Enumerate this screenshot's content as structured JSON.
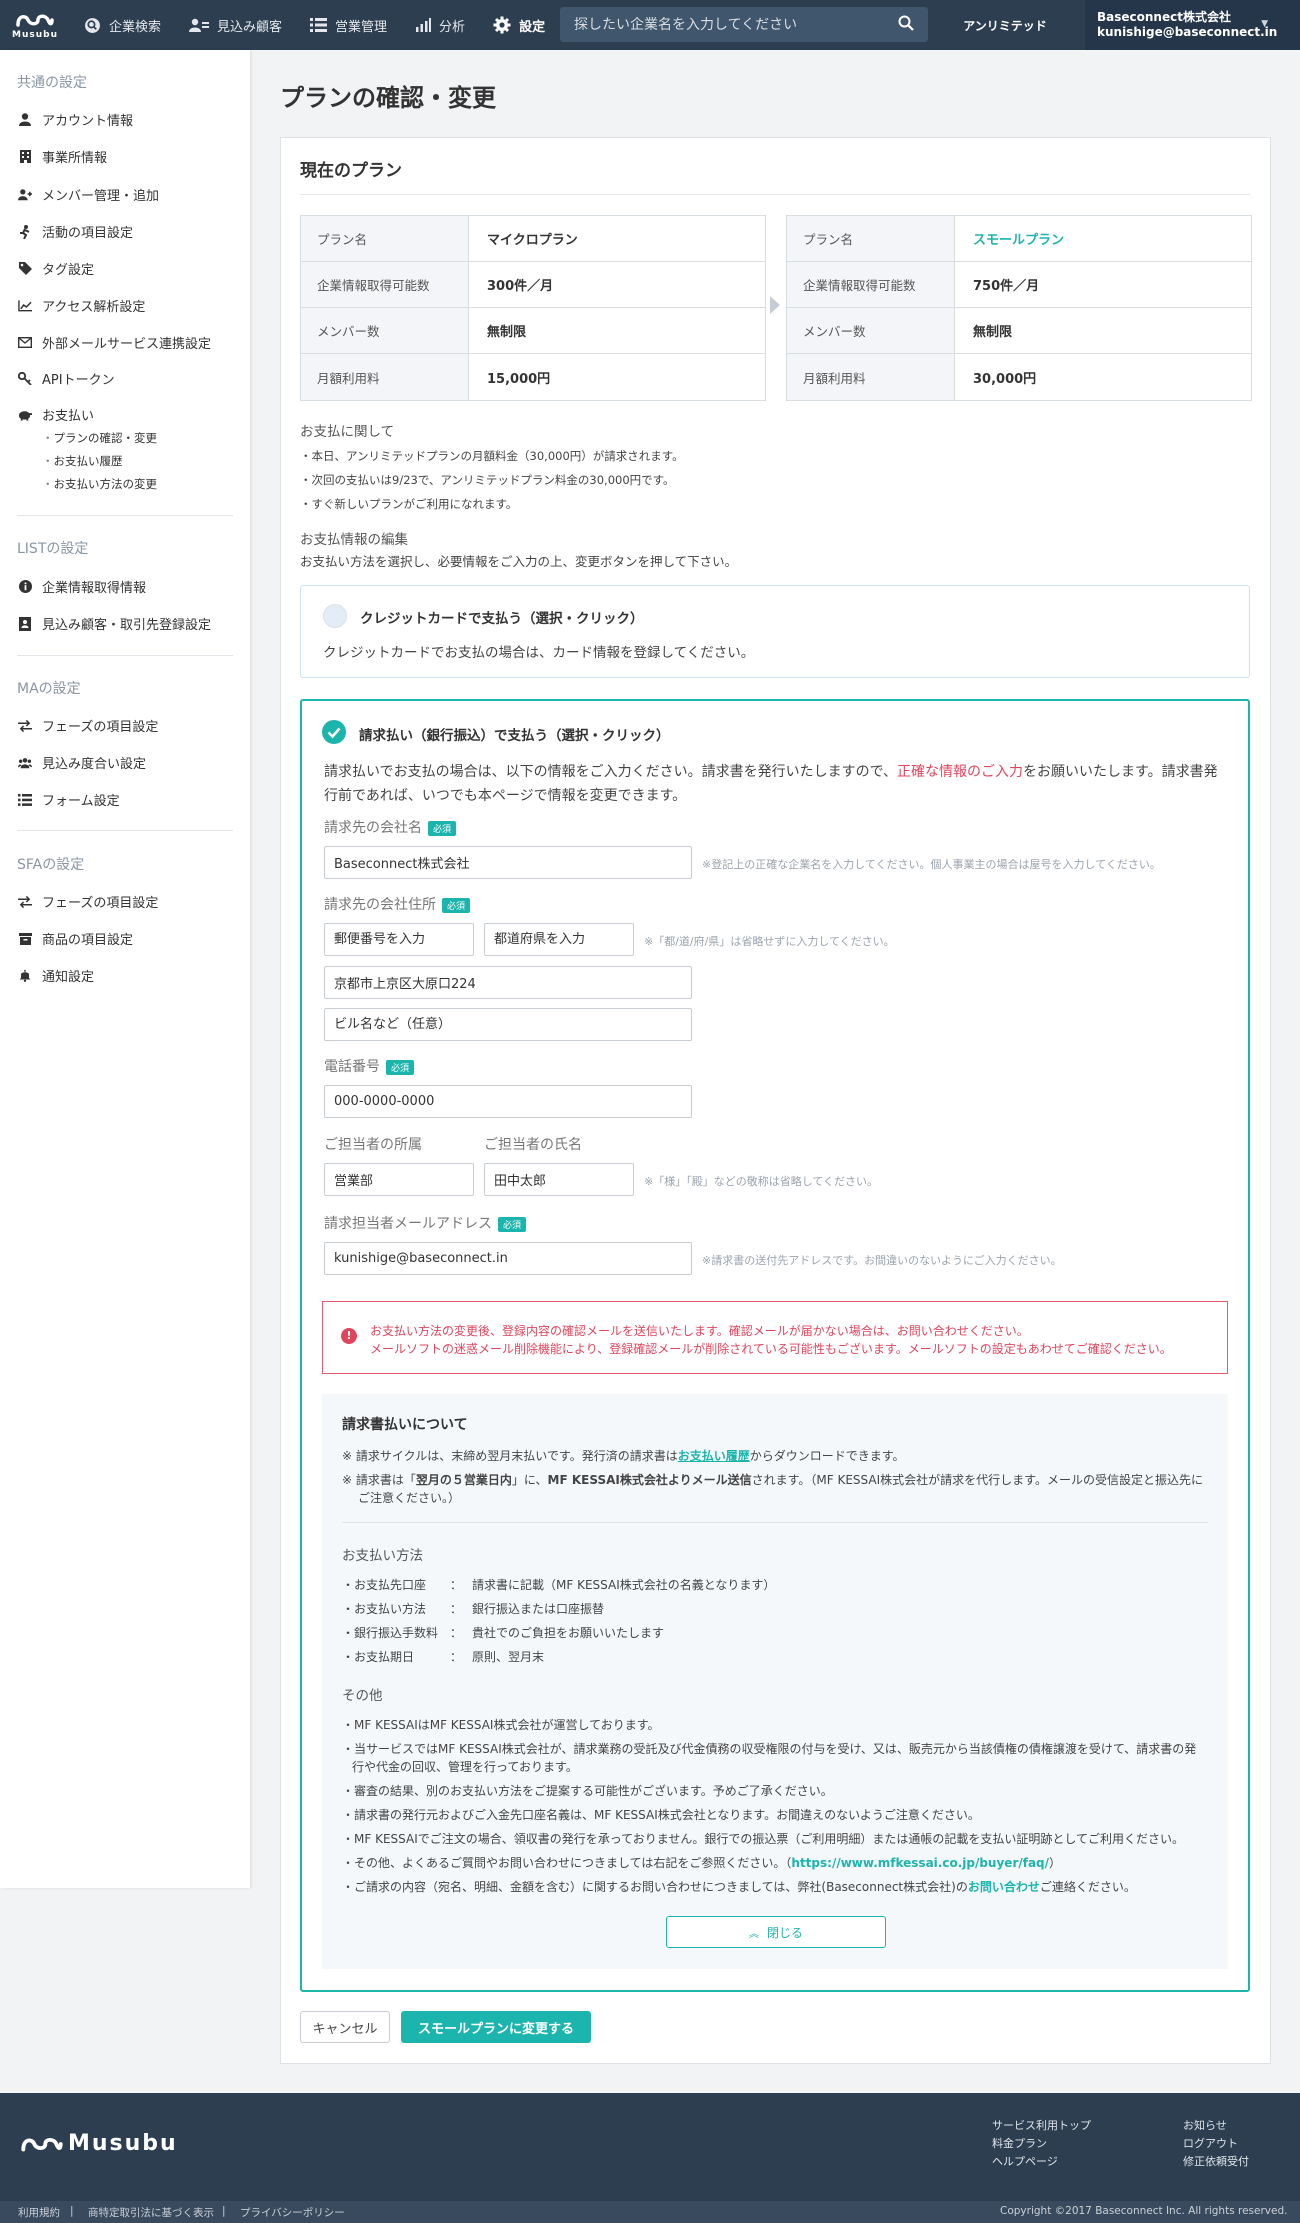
{
  "header": {
    "logo_text": "Musubu",
    "nav": [
      {
        "label": "企業検索",
        "icon": "search-circle-icon"
      },
      {
        "label": "見込み顧客",
        "icon": "users-icon"
      },
      {
        "label": "営業管理",
        "icon": "list-icon"
      },
      {
        "label": "分析",
        "icon": "bar-chart-icon"
      },
      {
        "label": "設定",
        "icon": "gear-icon"
      }
    ],
    "search_placeholder": "探したい企業名を入力してください",
    "plan_badge": "アンリミテッド",
    "company": "Baseconnect株式会社",
    "email": "kunishige@baseconnect.in"
  },
  "sidebar": {
    "common_title": "共通の設定",
    "common_items": [
      {
        "label": "アカウント情報",
        "icon": "user-icon"
      },
      {
        "label": "事業所情報",
        "icon": "building-icon"
      },
      {
        "label": "メンバー管理・追加",
        "icon": "user-plus-icon"
      },
      {
        "label": "活動の項目設定",
        "icon": "running-icon"
      },
      {
        "label": "タグ設定",
        "icon": "tag-icon"
      },
      {
        "label": "アクセス解析設定",
        "icon": "line-chart-icon"
      },
      {
        "label": "外部メールサービス連携設定",
        "icon": "envelope-icon"
      },
      {
        "label": "APIトークン",
        "icon": "key-icon"
      },
      {
        "label": "お支払い",
        "icon": "piggy-bank-icon"
      }
    ],
    "payment_sub": [
      "プランの確認・変更",
      "お支払い履歴",
      "お支払い方法の変更"
    ],
    "list_title": "LISTの設定",
    "list_items": [
      {
        "label": "企業情報取得情報",
        "icon": "info-icon"
      },
      {
        "label": "見込み顧客・取引先登録設定",
        "icon": "id-card-icon"
      }
    ],
    "ma_title": "MAの設定",
    "ma_items": [
      {
        "label": "フェーズの項目設定",
        "icon": "exchange-icon"
      },
      {
        "label": "見込み度合い設定",
        "icon": "group-icon"
      },
      {
        "label": "フォーム設定",
        "icon": "list-icon"
      }
    ],
    "sfa_title": "SFAの設定",
    "sfa_items": [
      {
        "label": "フェーズの項目設定",
        "icon": "exchange-icon"
      },
      {
        "label": "商品の項目設定",
        "icon": "archive-icon"
      },
      {
        "label": "通知設定",
        "icon": "bell-icon"
      }
    ]
  },
  "page": {
    "title": "プランの確認・変更",
    "current_plan_title": "現在のプラン"
  },
  "plans": {
    "current": [
      {
        "key": "プラン名",
        "value": "マイクロプラン"
      },
      {
        "key": "企業情報取得可能数",
        "value": "300件／月"
      },
      {
        "key": "メンバー数",
        "value": "無制限"
      },
      {
        "key": "月額利用料",
        "value": "15,000円"
      }
    ],
    "new": [
      {
        "key": "プラン名",
        "value": "スモールプラン"
      },
      {
        "key": "企業情報取得可能数",
        "value": "750件／月"
      },
      {
        "key": "メンバー数",
        "value": "無制限"
      },
      {
        "key": "月額利用料",
        "value": "30,000円"
      }
    ]
  },
  "payment_notes": {
    "title": "お支払に関して",
    "lines": [
      "・本日、アンリミテッドプランの月額料金（30,000円）が請求されます。",
      "・次回の支払いは9/23で、アンリミテッドプラン料金の30,000円です。",
      "・すぐ新しいプランがご利用になれます。"
    ],
    "edit_title": "お支払情報の編集",
    "edit_desc": "お支払い方法を選択し、必要情報をご入力の上、変更ボタンを押して下さい。"
  },
  "option_card": {
    "title": "クレジットカードで支払う（選択・クリック）",
    "desc": "クレジットカードでお支払の場合は、カード情報を登録してください。"
  },
  "option_invoice": {
    "title": "請求払い（銀行振込）で支払う（選択・クリック）",
    "desc_1": "請求払いでお支払の場合は、以下の情報をご入力ください。請求書を発行いたしますので、",
    "desc_highlight": "正確な情報のご入力",
    "desc_2": "をお願いいたします。請求書発",
    "desc_3": "行前であれば、いつでも本ページで情報を変更できます。"
  },
  "form": {
    "required": "必須",
    "company_label": "請求先の会社名",
    "company_value": "Baseconnect株式会社",
    "company_hint": "※登記上の正確な企業名を入力してください。個人事業主の場合は屋号を入力してください。",
    "address_label": "請求先の会社住所",
    "zip_placeholder": "郵便番号を入力",
    "pref_placeholder": "都道府県を入力",
    "address_hint": "※「都/道/府/県」は省略せずに入力してください。",
    "address_value": "京都市上京区大原口224",
    "building_placeholder": "ビル名など（任意）",
    "phone_label": "電話番号",
    "phone_value": "000-0000-0000",
    "dept_label": "ご担当者の所属",
    "name_label": "ご担当者の氏名",
    "dept_value": "営業部",
    "name_value": "田中太郎",
    "name_hint": "※「様」「殿」などの敬称は省略してください。",
    "email_label": "請求担当者メールアドレス",
    "email_value": "kunishige@baseconnect.in",
    "email_hint": "※請求書の送付先アドレスです。お間違いのないようにご入力ください。"
  },
  "alert": {
    "line1": "お支払い方法の変更後、登録内容の確認メールを送信いたします。確認メールが届かない場合は、お問い合わせください。",
    "line2": "メールソフトの迷惑メール削除機能により、登録確認メールが削除されている可能性もございます。メールソフトの設定もあわせてご確認ください。"
  },
  "invoice_info": {
    "title": "請求書払いについて",
    "note1_a": "※ 請求サイクルは、末締め翌月末払いです。発行済の請求書は",
    "note1_link": "お支払い履歴",
    "note1_b": "からダウンロードできます。",
    "note2_a": "※ 請求書は「",
    "note2_b": "翌月の５営業日内",
    "note2_c": "」に、",
    "note2_d": "MF KESSAI株式会社よりメール送信",
    "note2_e": "されます。（MF KESSAI株式会社が請求を代行します。メールの受信設定と振込先に",
    "note2_f": "ご注意ください。）",
    "method_title": "お支払い方法",
    "methods": [
      {
        "k": "・お支払先口座",
        "v": "請求書に記載（MF KESSAI株式会社の名義となります）"
      },
      {
        "k": "・お支払い方法",
        "v": "銀行振込または口座振替"
      },
      {
        "k": "・銀行振込手数料",
        "v": "貴社でのご負担をお願いいたします"
      },
      {
        "k": "・お支払期日",
        "v": "原則、翌月末"
      }
    ],
    "colon": "：",
    "other_title": "その他",
    "others": [
      "・MF KESSAIはMF KESSAI株式会社が運営しております。",
      "・当サービスではMF KESSAI株式会社が、請求業務の受託及び代金債務の収受権限の付与を受け、又は、販売元から当該債権の債権譲渡を受けて、請求書の発",
      "行や代金の回収、管理を行っております。",
      "・審査の結果、別のお支払い方法をご提案する可能性がございます。予めご了承ください。",
      "・請求書の発行元およびご入金先口座名義は、MF KESSAI株式会社となります。お間違えのないようご注意ください。",
      "・MF KESSAIでご注文の場合、領収書の発行を承っておりません。銀行での振込票（ご利用明細）または通帳の記載を支払い証明跡としてご利用ください。"
    ],
    "faq_a": "・その他、よくあるご質問やお問い合わせにつきましては右記をご参照ください。（",
    "faq_link": "https://www.mfkessai.co.jp/buyer/faq/",
    "faq_b": "）",
    "contact_a": "・ご請求の内容（宛名、明細、金額を含む）に関するお問い合わせにつきましては、弊社(Baseconnect株式会社)の",
    "contact_link": "お問い合わせ",
    "contact_b": "ご連絡ください。",
    "close_label": "閉じる"
  },
  "actions": {
    "cancel": "キャンセル",
    "submit": "スモールプランに変更する"
  },
  "footer": {
    "logo_text": "Musubu",
    "links_col1": [
      "サービス利用トップ",
      "料金プラン",
      "ヘルプページ"
    ],
    "links_col2": [
      "お知らせ",
      "ログアウト",
      "修正依頼受付"
    ],
    "legal": [
      "利用規約",
      "商特定取引法に基づく表示",
      "プライバシーポリシー"
    ],
    "copyright": "Copyright ©2017 Baseconnect Inc. All rights reserved."
  },
  "colors": {
    "accent": "#1cb5ad",
    "header": "#2c3e50",
    "alert": "#e0455c"
  }
}
